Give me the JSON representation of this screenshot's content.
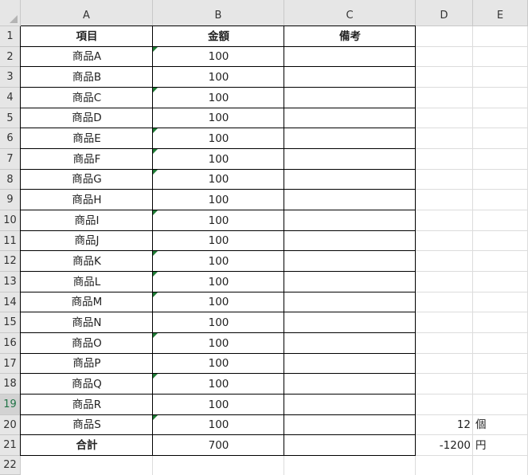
{
  "columns": [
    "A",
    "B",
    "C",
    "D",
    "E"
  ],
  "rows": [
    "1",
    "2",
    "3",
    "4",
    "5",
    "6",
    "7",
    "8",
    "9",
    "10",
    "11",
    "12",
    "13",
    "14",
    "15",
    "16",
    "17",
    "18",
    "19",
    "20",
    "21",
    "22"
  ],
  "selected_row": "19",
  "table": {
    "headers": {
      "item": "項目",
      "amount": "金額",
      "note": "備考"
    },
    "items": [
      {
        "name": "商品A",
        "amount": "100",
        "text_number": true
      },
      {
        "name": "商品B",
        "amount": "100",
        "text_number": false
      },
      {
        "name": "商品C",
        "amount": "100",
        "text_number": true
      },
      {
        "name": "商品D",
        "amount": "100",
        "text_number": false
      },
      {
        "name": "商品E",
        "amount": "100",
        "text_number": true
      },
      {
        "name": "商品F",
        "amount": "100",
        "text_number": true
      },
      {
        "name": "商品G",
        "amount": "100",
        "text_number": true
      },
      {
        "name": "商品H",
        "amount": "100",
        "text_number": false
      },
      {
        "name": "商品I",
        "amount": "100",
        "text_number": true
      },
      {
        "name": "商品J",
        "amount": "100",
        "text_number": false
      },
      {
        "name": "商品K",
        "amount": "100",
        "text_number": true
      },
      {
        "name": "商品L",
        "amount": "100",
        "text_number": true
      },
      {
        "name": "商品M",
        "amount": "100",
        "text_number": true
      },
      {
        "name": "商品N",
        "amount": "100",
        "text_number": false
      },
      {
        "name": "商品O",
        "amount": "100",
        "text_number": true
      },
      {
        "name": "商品P",
        "amount": "100",
        "text_number": false
      },
      {
        "name": "商品Q",
        "amount": "100",
        "text_number": true
      },
      {
        "name": "商品R",
        "amount": "100",
        "text_number": false
      },
      {
        "name": "商品S",
        "amount": "100",
        "text_number": true
      }
    ],
    "total_label": "合計",
    "total_amount": "700"
  },
  "side": {
    "count_value": "12",
    "count_unit": "個",
    "yen_value": "-1200",
    "yen_unit": "円"
  },
  "colors": {
    "header_bg": "#e6e6e6",
    "selected_header_bg": "#d2d2d2",
    "selected_header_text": "#217346",
    "error_triangle": "#1e7b34",
    "gridline": "#dcdcdc",
    "border": "#000000"
  }
}
